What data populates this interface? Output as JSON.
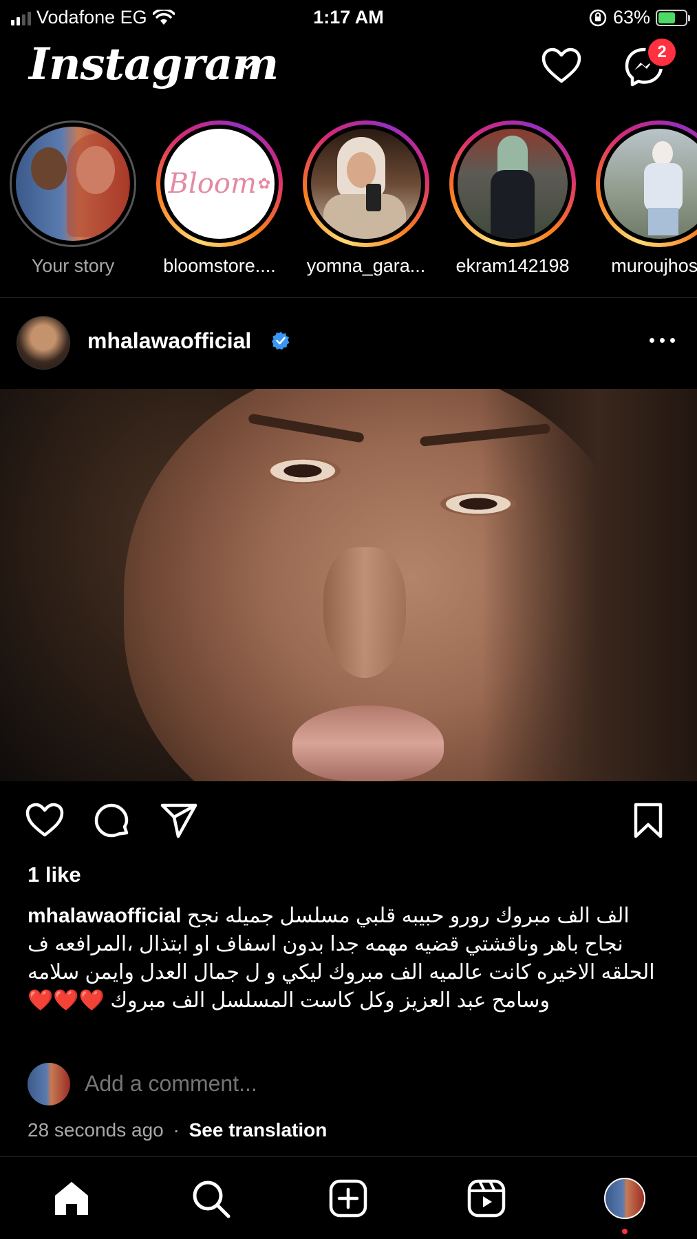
{
  "status_bar": {
    "carrier": "Vodafone EG",
    "time": "1:17 AM",
    "battery_percent": "63%",
    "battery_level": 0.63,
    "icons": [
      "signal-icon",
      "wifi-icon",
      "orientation-lock-icon",
      "battery-charging-icon"
    ]
  },
  "header": {
    "logo_text": "Instagram",
    "messages_badge": "2"
  },
  "stories": [
    {
      "label": "Your story",
      "seen": true
    },
    {
      "label": "bloomstore....",
      "seen": false,
      "logo_text": "Bloom"
    },
    {
      "label": "yomna_gara...",
      "seen": false
    },
    {
      "label": "ekram142198",
      "seen": false
    },
    {
      "label": "muroujhoss",
      "seen": false
    }
  ],
  "post": {
    "username": "mhalawaofficial",
    "likes": "1 like",
    "caption_user": "mhalawaofficial",
    "caption_text": "الف الف مبروك رورو حبيبه قلبي مسلسل جميله نجح نجاح باهر وناقشتي قضيه مهمه جدا بدون اسفاف او ابتذال ،المرافعه ف الحلقه الاخيره كانت عالميه  الف مبروك ليكي و ل جمال العدل وايمن سلامه وسامح عبد العزيز وكل كاست المسلسل الف مبروك ❤️❤️❤️",
    "comment_placeholder": "Add a comment...",
    "time_ago": "28 seconds ago",
    "separator": "·",
    "see_translation": "See translation"
  },
  "accent": {
    "badge_red": "#ff3040",
    "verified_blue": "#3897f0",
    "battery_green": "#4cd964"
  }
}
